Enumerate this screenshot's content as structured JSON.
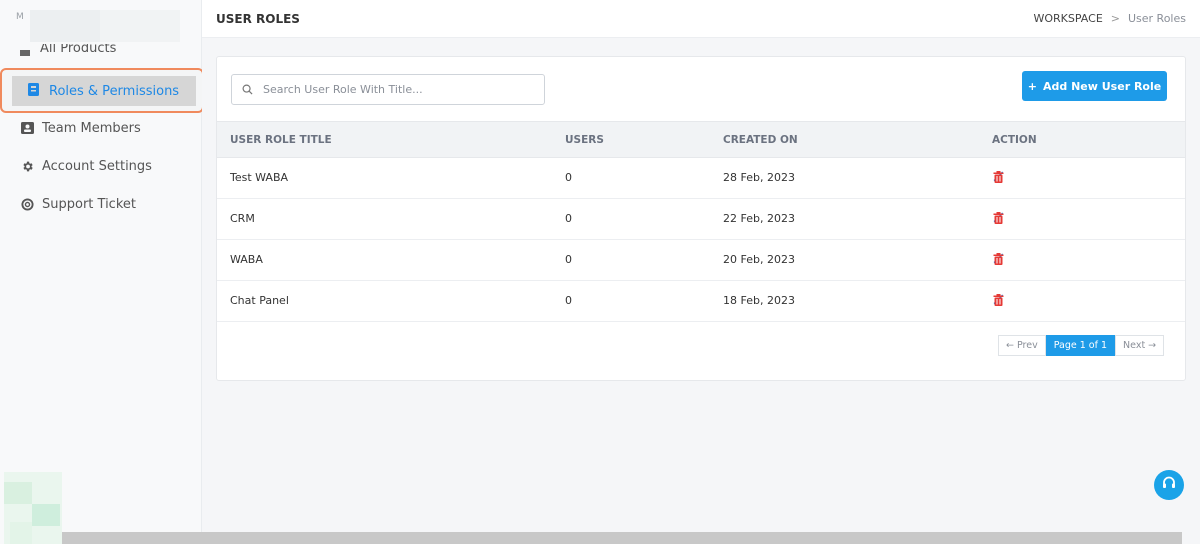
{
  "sidebar": {
    "top_char": "M",
    "partial_item": "All Products",
    "active_item": {
      "label": "Roles & Permissions",
      "icon": "id-badge-icon"
    },
    "items": [
      {
        "label": "Team Members",
        "icon": "contact-book-icon"
      },
      {
        "label": "Account Settings",
        "icon": "gear-icon"
      },
      {
        "label": "Support Ticket",
        "icon": "lifebuoy-icon"
      }
    ]
  },
  "header": {
    "title": "USER ROLES",
    "breadcrumb": {
      "root": "WORKSPACE",
      "separator": ">",
      "current": "User Roles"
    }
  },
  "toolbar": {
    "search_placeholder": "Search User Role With Title...",
    "add_button": "Add New User Role",
    "add_icon": "+"
  },
  "table": {
    "columns": [
      "USER ROLE TITLE",
      "USERS",
      "CREATED ON",
      "ACTION"
    ],
    "rows": [
      {
        "title": "Test WABA",
        "users": "0",
        "created": "28 Feb, 2023"
      },
      {
        "title": "CRM",
        "users": "0",
        "created": "22 Feb, 2023"
      },
      {
        "title": "WABA",
        "users": "0",
        "created": "20 Feb, 2023"
      },
      {
        "title": "Chat Panel",
        "users": "0",
        "created": "18 Feb, 2023"
      }
    ]
  },
  "pagination": {
    "prev": "← Prev",
    "current": "Page 1 of 1",
    "next": "Next →"
  },
  "colors": {
    "accent": "#1e9be8",
    "delete": "#e53935",
    "edit": "#1e88e5",
    "active_border": "#f08a5d"
  }
}
